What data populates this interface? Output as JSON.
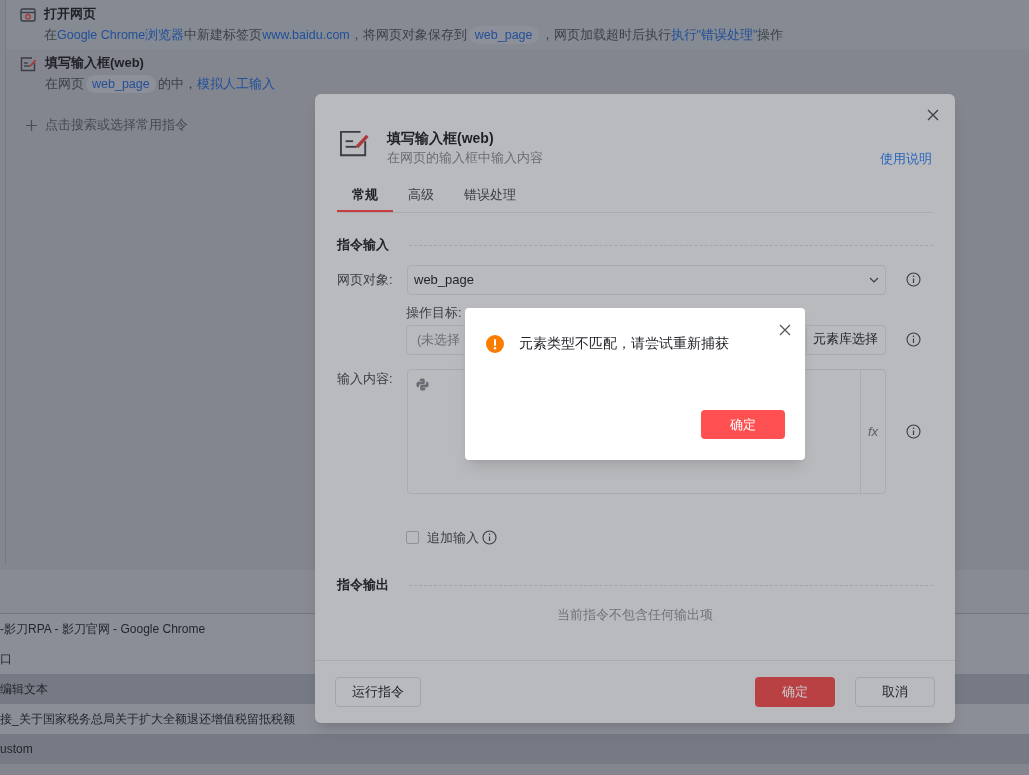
{
  "flow": {
    "steps": [
      {
        "kind": "browser",
        "title": "打开网页",
        "description": [
          {
            "kind": "text",
            "text": "在"
          },
          {
            "kind": "link",
            "text": "Google Chrome浏览器"
          },
          {
            "kind": "text",
            "text": "中新建标签页"
          },
          {
            "kind": "link",
            "text": "www.baidu.com"
          },
          {
            "kind": "text",
            "text": "，将网页对象保存到"
          },
          {
            "kind": "var",
            "text": "web_page"
          },
          {
            "kind": "text",
            "text": "，网页加载超时后执行"
          },
          {
            "kind": "link",
            "text": "执行\"错误处理\""
          },
          {
            "kind": "text",
            "text": "操作"
          }
        ]
      },
      {
        "kind": "input",
        "title": "填写输入框(web)",
        "description": [
          {
            "kind": "text",
            "text": "在网页"
          },
          {
            "kind": "var",
            "text": "web_page"
          },
          {
            "kind": "text",
            "text": "的中，"
          },
          {
            "kind": "link",
            "text": "模拟人工输入"
          }
        ]
      }
    ],
    "add_command": "点击搜索或选择常用指令"
  },
  "bottom_panel": {
    "rows": [
      {
        "text": "-影刀RPA - 影刀官网 - Google Chrome",
        "highlighted": false
      },
      {
        "text": "口",
        "highlighted": false
      },
      {
        "text": "编辑文本",
        "highlighted": true
      },
      {
        "text": "接_关于国家税务总局关于扩大全额退还增值税留抵税额",
        "highlighted": false
      },
      {
        "text": "ustom",
        "highlighted": true
      }
    ]
  },
  "dialog": {
    "title": "填写输入框(web)",
    "subtitle": "在网页的输入框中输入内容",
    "help_link": "使用说明",
    "tabs": [
      {
        "label": "常规",
        "selected": true
      },
      {
        "label": "高级",
        "selected": false
      },
      {
        "label": "错误处理",
        "selected": false
      }
    ],
    "input_section": "指令输入",
    "page_object": {
      "label": "网页对象:",
      "value": "web_page"
    },
    "target": {
      "label": "操作目标:",
      "placeholder": "(未选择",
      "button": "元素库选择"
    },
    "content": {
      "label": "输入内容:",
      "fx": "fx"
    },
    "append": {
      "label": "追加输入",
      "checked": false
    },
    "output_section": "指令输出",
    "output_empty": "当前指令不包含任何输出项",
    "run_button": "运行指令",
    "ok_button": "确定",
    "cancel_button": "取消"
  },
  "alert": {
    "message": "元素类型不匹配，请尝试重新捕获",
    "ok_button": "确定"
  }
}
